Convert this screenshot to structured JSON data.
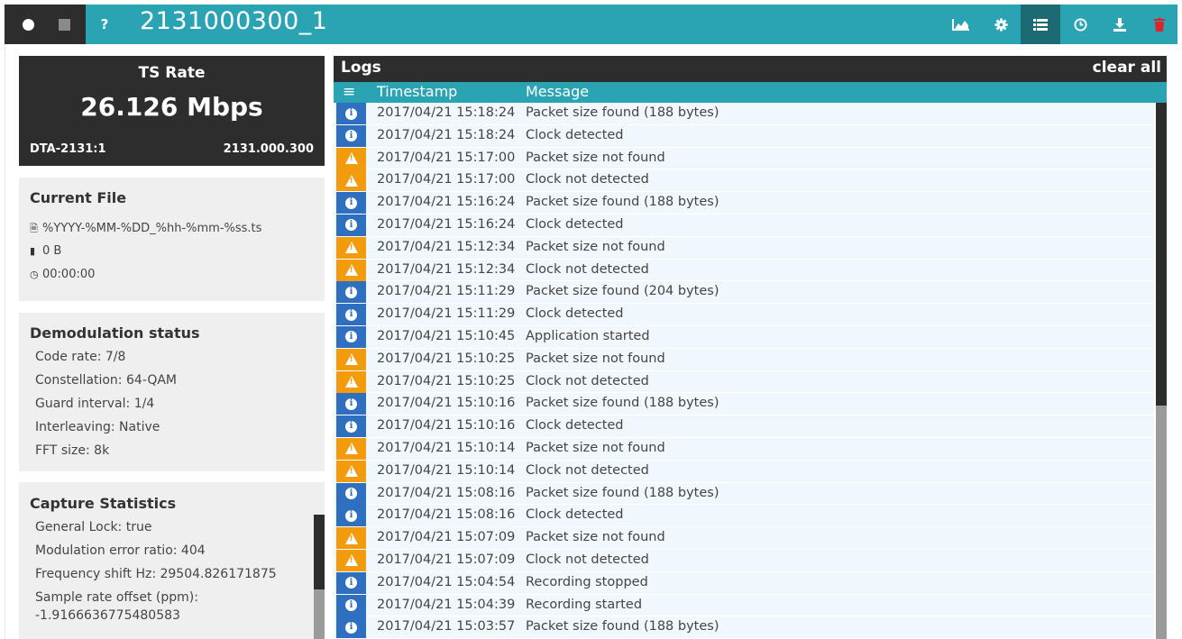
{
  "header": {
    "title": "2131000300_1",
    "help_label": "?",
    "left_controls": [
      "record-dot",
      "stop-square"
    ],
    "right_icons": [
      "chart-icon",
      "gear-icon",
      "list-icon",
      "clock-icon",
      "download-icon",
      "trash-icon"
    ]
  },
  "ts_rate": {
    "label": "TS Rate",
    "value": "26.126 Mbps",
    "device": "DTA-2131:1",
    "port": "2131.000.300"
  },
  "current_file": {
    "title": "Current File",
    "filename": "%YYYY-%MM-%DD_%hh-%mm-%ss.ts",
    "size": "0 B",
    "duration": "00:00:00"
  },
  "demod": {
    "title": "Demodulation status",
    "items": [
      "Code rate: 7/8",
      "Constellation: 64-QAM",
      "Guard interval: 1/4",
      "Interleaving: Native",
      "FFT size: 8k"
    ]
  },
  "capture": {
    "title": "Capture Statistics",
    "items": [
      "General Lock: true",
      "Modulation error ratio: 404",
      "Frequency shift Hz: 29504.826171875",
      "Sample rate offset (ppm):",
      "-1.9166636775480583"
    ]
  },
  "logs": {
    "title": "Logs",
    "clear_label": "clear all",
    "col_timestamp": "Timestamp",
    "col_message": "Message",
    "rows": [
      {
        "level": "info",
        "ts": "2017/04/21 15:18:24",
        "msg": "Packet size found (188 bytes)"
      },
      {
        "level": "info",
        "ts": "2017/04/21 15:18:24",
        "msg": "Clock detected"
      },
      {
        "level": "warn",
        "ts": "2017/04/21 15:17:00",
        "msg": "Packet size not found"
      },
      {
        "level": "warn",
        "ts": "2017/04/21 15:17:00",
        "msg": "Clock not detected"
      },
      {
        "level": "info",
        "ts": "2017/04/21 15:16:24",
        "msg": "Packet size found (188 bytes)"
      },
      {
        "level": "info",
        "ts": "2017/04/21 15:16:24",
        "msg": "Clock detected"
      },
      {
        "level": "warn",
        "ts": "2017/04/21 15:12:34",
        "msg": "Packet size not found"
      },
      {
        "level": "warn",
        "ts": "2017/04/21 15:12:34",
        "msg": "Clock not detected"
      },
      {
        "level": "info",
        "ts": "2017/04/21 15:11:29",
        "msg": "Packet size found (204 bytes)"
      },
      {
        "level": "info",
        "ts": "2017/04/21 15:11:29",
        "msg": "Clock detected"
      },
      {
        "level": "info",
        "ts": "2017/04/21 15:10:45",
        "msg": "Application started"
      },
      {
        "level": "warn",
        "ts": "2017/04/21 15:10:25",
        "msg": "Packet size not found"
      },
      {
        "level": "warn",
        "ts": "2017/04/21 15:10:25",
        "msg": "Clock not detected"
      },
      {
        "level": "info",
        "ts": "2017/04/21 15:10:16",
        "msg": "Packet size found (188 bytes)"
      },
      {
        "level": "info",
        "ts": "2017/04/21 15:10:16",
        "msg": "Clock detected"
      },
      {
        "level": "warn",
        "ts": "2017/04/21 15:10:14",
        "msg": "Packet size not found"
      },
      {
        "level": "warn",
        "ts": "2017/04/21 15:10:14",
        "msg": "Clock not detected"
      },
      {
        "level": "info",
        "ts": "2017/04/21 15:08:16",
        "msg": "Packet size found (188 bytes)"
      },
      {
        "level": "info",
        "ts": "2017/04/21 15:08:16",
        "msg": "Clock detected"
      },
      {
        "level": "warn",
        "ts": "2017/04/21 15:07:09",
        "msg": "Packet size not found"
      },
      {
        "level": "warn",
        "ts": "2017/04/21 15:07:09",
        "msg": "Clock not detected"
      },
      {
        "level": "info",
        "ts": "2017/04/21 15:04:54",
        "msg": "Recording stopped"
      },
      {
        "level": "info",
        "ts": "2017/04/21 15:04:39",
        "msg": "Recording started"
      },
      {
        "level": "info",
        "ts": "2017/04/21 15:03:57",
        "msg": "Packet size found (188 bytes)"
      }
    ]
  },
  "colors": {
    "accent": "#2aa3b3",
    "dark": "#2d2d2d",
    "info": "#2f6fbf",
    "warn": "#f29b0c",
    "row_bg": "#f0f7fd"
  }
}
